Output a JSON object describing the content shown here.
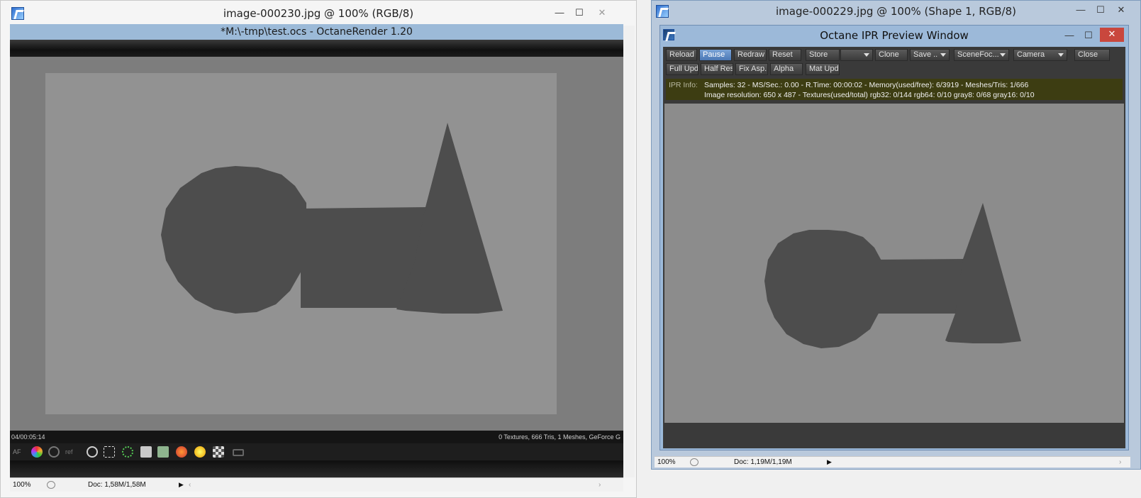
{
  "left_window": {
    "title": "image-000230.jpg @ 100% (RGB/8)",
    "controls": {
      "minimize": "—",
      "maximize": "☐",
      "close": "✕"
    },
    "octane_title": "*M:\\-tmp\\test.ocs - OctaneRender 1.20",
    "render_time": "04/00:05:14",
    "scene_stats": "0 Textures, 666 Tris, 1 Meshes, GeForce G",
    "toolbar_icons": [
      "af-icon",
      "color-wheel-icon",
      "refresh-icon",
      "ref-icon",
      "zoom-icon",
      "region-icon",
      "spinner-icon",
      "clipboard-icon",
      "save-icon",
      "paint-icon",
      "sun-icon",
      "checker-icon",
      "lock-icon"
    ],
    "toolbar_text": {
      "af": "AF",
      "ref": "ref"
    },
    "status": {
      "zoom": "100%",
      "doc": "Doc: 1,58M/1,58M"
    }
  },
  "right_window": {
    "title": "image-000229.jpg @ 100% (Shape 1, RGB/8)",
    "controls": {
      "minimize": "—",
      "maximize": "☐",
      "close": "✕"
    },
    "ipr": {
      "title": "Octane IPR Preview Window",
      "controls": {
        "minimize": "—",
        "maximize": "☐",
        "close": "✕"
      },
      "row1": [
        "Reload",
        "Pause",
        "Redraw",
        "Reset",
        "Store",
        "",
        "Clone",
        "Save ..",
        "SceneFoc...",
        "Camera",
        "Close"
      ],
      "row2": [
        "Full Upd.",
        "Half Res",
        "Fix Asp.",
        "Alpha",
        "Mat Upd"
      ],
      "info_label": "IPR Info:",
      "info_line1": "Samples: 32  -  MS/Sec.: 0.00  -  R.Time: 00:00:02 - Memory(used/free): 6/3919  -  Meshes/Tris: 1/666",
      "info_line2": "Image resolution: 650 x 487 - Textures(used/total) rgb32: 0/144   rgb64: 0/10   gray8: 0/68   gray16: 0/10"
    },
    "status": {
      "zoom": "100%",
      "doc": "Doc: 1,19M/1,19M"
    }
  },
  "colors": {
    "octane_bar": "#9cbad8",
    "shape": "#4d4d4d",
    "render_bg": "#929292",
    "close_red": "#c9473d",
    "info_bg": "#3d3d12"
  }
}
